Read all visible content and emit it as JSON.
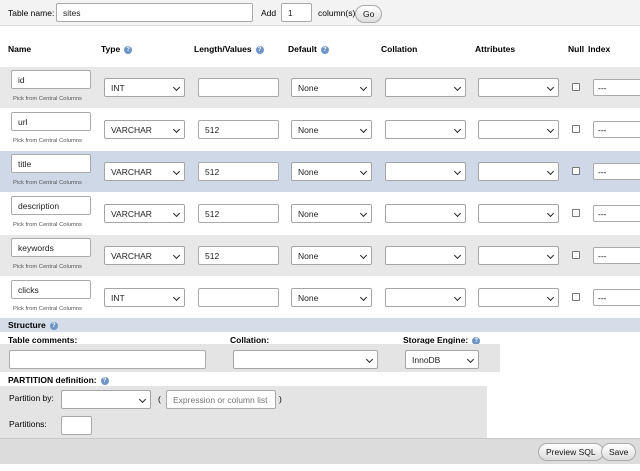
{
  "top": {
    "table_name_label": "Table name:",
    "table_name_value": "sites",
    "add_label": "Add",
    "add_value": "1",
    "columns_label": "column(s)",
    "go_button": "Go"
  },
  "headers": {
    "name": "Name",
    "type": "Type",
    "length": "Length/Values",
    "default": "Default",
    "collation": "Collation",
    "attributes": "Attributes",
    "null": "Null",
    "index": "Index"
  },
  "pick_label": "Pick from Central Columns",
  "columns": [
    {
      "name": "id",
      "type": "INT",
      "length": "",
      "default": "None",
      "index": "---"
    },
    {
      "name": "url",
      "type": "VARCHAR",
      "length": "512",
      "default": "None",
      "index": "---"
    },
    {
      "name": "title",
      "type": "VARCHAR",
      "length": "512",
      "default": "None",
      "index": "---"
    },
    {
      "name": "description",
      "type": "VARCHAR",
      "length": "512",
      "default": "None",
      "index": "---"
    },
    {
      "name": "keywords",
      "type": "VARCHAR",
      "length": "512",
      "default": "None",
      "index": "---"
    },
    {
      "name": "clicks",
      "type": "INT",
      "length": "",
      "default": "None",
      "index": "---"
    }
  ],
  "structure": {
    "title": "Structure",
    "table_comments_label": "Table comments:",
    "collation_label": "Collation:",
    "storage_engine_label": "Storage Engine:",
    "storage_engine_value": "InnoDB"
  },
  "partition": {
    "title": "PARTITION definition:",
    "partition_by_label": "Partition by:",
    "open_paren": "(",
    "expression_placeholder": "Expression or column list",
    "close_paren": ")",
    "partitions_label": "Partitions:"
  },
  "footer": {
    "preview_button": "Preview SQL",
    "save_button": "Save"
  },
  "colors": {
    "row_light": "#e8e8e8",
    "row_highlight": "#ced8e6",
    "structure_bar": "#d5dde8",
    "help_icon": "#6f95c7"
  }
}
